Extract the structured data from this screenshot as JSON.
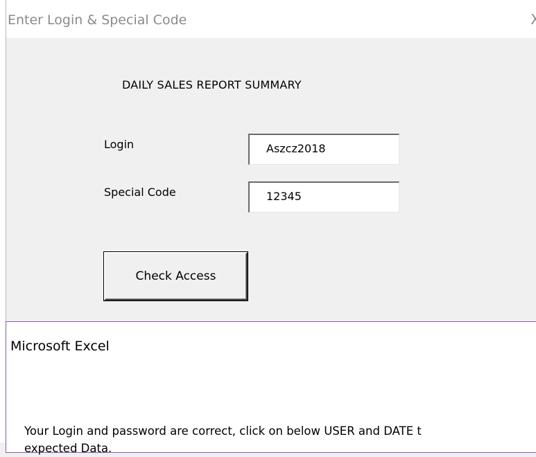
{
  "window": {
    "title": "Enter Login & Special Code",
    "close_glyph": "X"
  },
  "form": {
    "heading": "DAILY SALES REPORT SUMMARY",
    "login_label": "Login",
    "login_value": "Aszcz2018",
    "special_code_label": "Special Code",
    "special_code_value": "12345",
    "check_access_label": "Check Access"
  },
  "message_box": {
    "title": "Microsoft Excel",
    "message_line1": "Your Login and password are correct, click on below USER and DATE t",
    "message_line2": "expected Data."
  },
  "colors": {
    "dialog_bg": "#f0f0f0",
    "title_text": "#8a8a8a",
    "msgbox_border": "#8c5aa8"
  }
}
